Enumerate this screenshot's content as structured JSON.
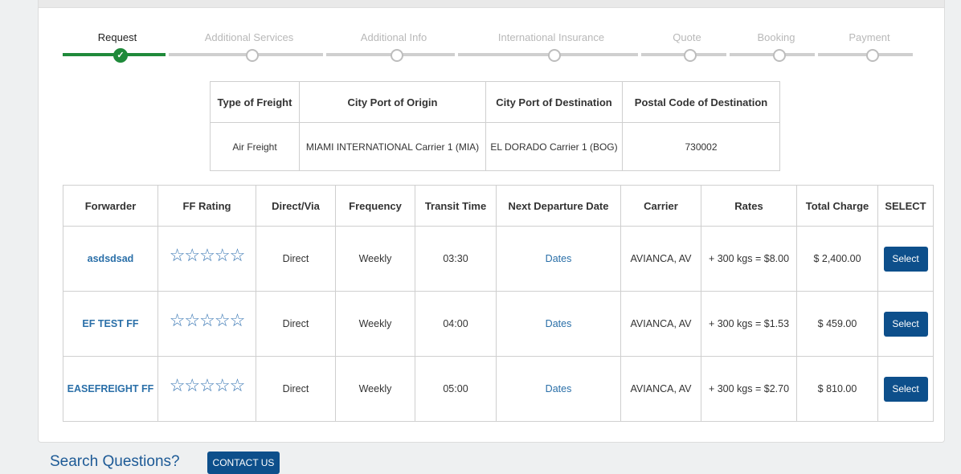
{
  "stepper": {
    "steps": [
      {
        "label": "Request"
      },
      {
        "label": "Additional Services"
      },
      {
        "label": "Additional Info"
      },
      {
        "label": "International Insurance"
      },
      {
        "label": "Quote"
      },
      {
        "label": "Booking"
      },
      {
        "label": "Payment"
      }
    ],
    "active_check": "✓"
  },
  "summary": {
    "headers": [
      "Type of Freight",
      "City Port of Origin",
      "City Port of Destination",
      "Postal Code of Destination"
    ],
    "row": [
      "Air Freight",
      "MIAMI INTERNATIONAL Carrier 1 (MIA)",
      "EL DORADO Carrier 1 (BOG)",
      "730002"
    ]
  },
  "results": {
    "headers": [
      "Forwarder",
      "FF Rating",
      "Direct/Via",
      "Frequency",
      "Transit Time",
      "Next Departure Date",
      "Carrier",
      "Rates",
      "Total Charge",
      "SELECT"
    ],
    "rows": [
      {
        "forwarder": "asdsdsad",
        "rating": "☆☆☆☆☆",
        "direct": "Direct",
        "frequency": "Weekly",
        "transit": "03:30",
        "departure": "Dates",
        "carrier": "AVIANCA, AV",
        "rates": "+ 300 kgs = $8.00",
        "total": "$ 2,400.00",
        "select": "Select"
      },
      {
        "forwarder": "EF TEST FF",
        "rating": "☆☆☆☆☆",
        "direct": "Direct",
        "frequency": "Weekly",
        "transit": "04:00",
        "departure": "Dates",
        "carrier": "AVIANCA, AV",
        "rates": "+ 300 kgs = $1.53",
        "total": "$ 459.00",
        "select": "Select"
      },
      {
        "forwarder": "EASEFREIGHT FF",
        "rating": "☆☆☆☆☆",
        "direct": "Direct",
        "frequency": "Weekly",
        "transit": "05:00",
        "departure": "Dates",
        "carrier": "AVIANCA, AV",
        "rates": "+ 300 kgs = $2.70",
        "total": "$ 810.00",
        "select": "Select"
      }
    ]
  },
  "footer": {
    "title": "Search Questions?",
    "contact": "CONTACT US"
  }
}
